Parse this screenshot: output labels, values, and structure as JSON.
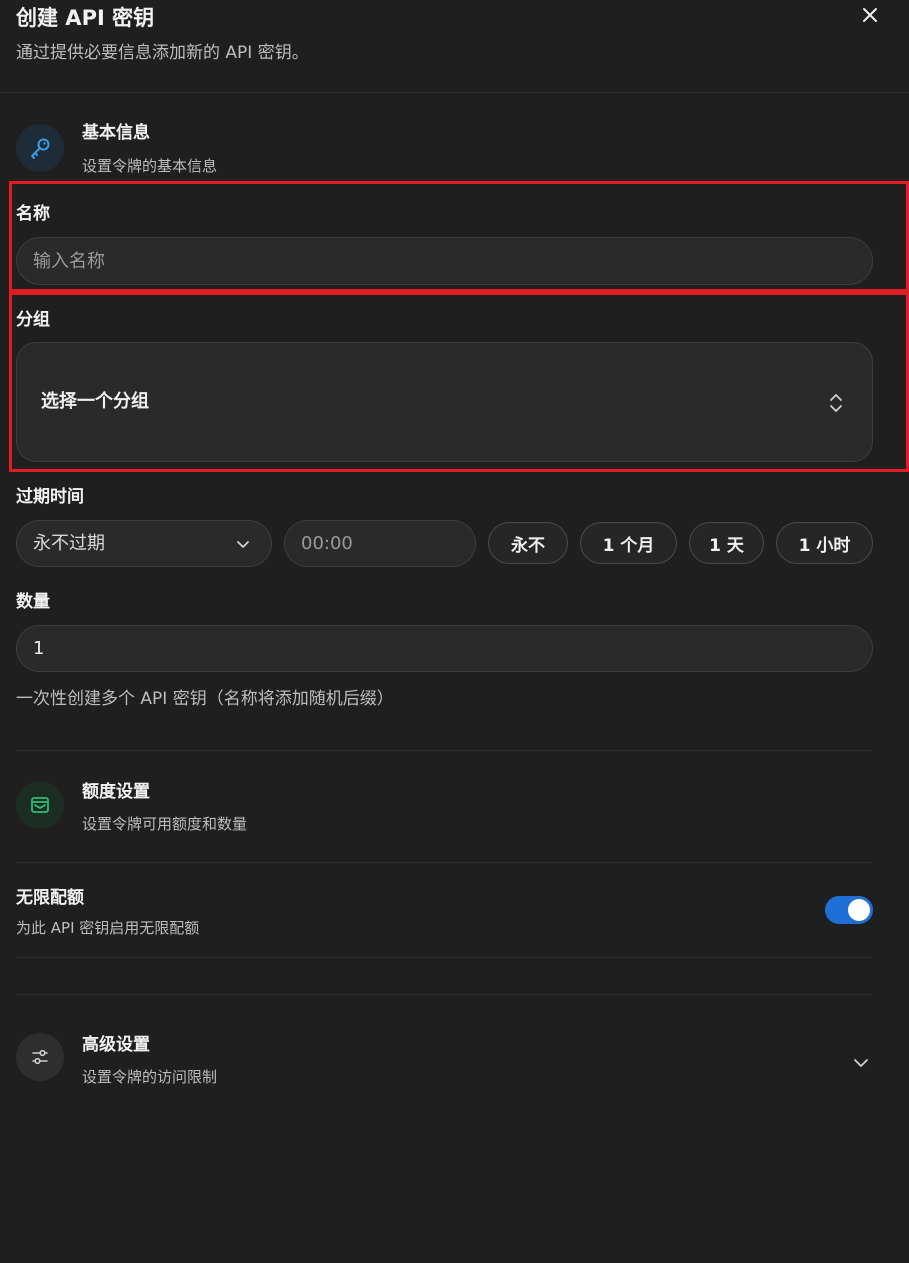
{
  "dialog": {
    "title": "创建 API 密钥",
    "subtitle": "通过提供必要信息添加新的 API 密钥。",
    "close_icon": "close-icon"
  },
  "basic_section": {
    "icon": "key-icon",
    "title": "基本信息",
    "description": "设置令牌的基本信息"
  },
  "name_field": {
    "label": "名称",
    "placeholder": "输入名称",
    "value": ""
  },
  "group_field": {
    "label": "分组",
    "placeholder": "选择一个分组",
    "icon": "chevron-up-down-icon"
  },
  "expiration": {
    "label": "过期时间",
    "selected": "永不过期",
    "time_placeholder": "00:00",
    "quick_options": [
      "永不",
      "1 个月",
      "1 天",
      "1 小时"
    ]
  },
  "quantity": {
    "label": "数量",
    "value": "1",
    "hint": "一次性创建多个 API 密钥（名称将添加随机后缀）"
  },
  "quota_section": {
    "icon": "wallet-icon",
    "title": "额度设置",
    "description": "设置令牌可用额度和数量"
  },
  "unlimited_quota": {
    "title": "无限配额",
    "description": "为此 API 密钥启用无限配额",
    "enabled": true
  },
  "advanced_section": {
    "icon": "sliders-icon",
    "title": "高级设置",
    "description": "设置令牌的访问限制",
    "toggle_icon": "chevron-down-icon"
  },
  "colors": {
    "background": "#1f1f1f",
    "field": "#2a2a2a",
    "accent": "#1f6fd6",
    "key_icon": "#3b9ce8",
    "quota_icon": "#2fbf71",
    "highlight": "#e01b24"
  }
}
